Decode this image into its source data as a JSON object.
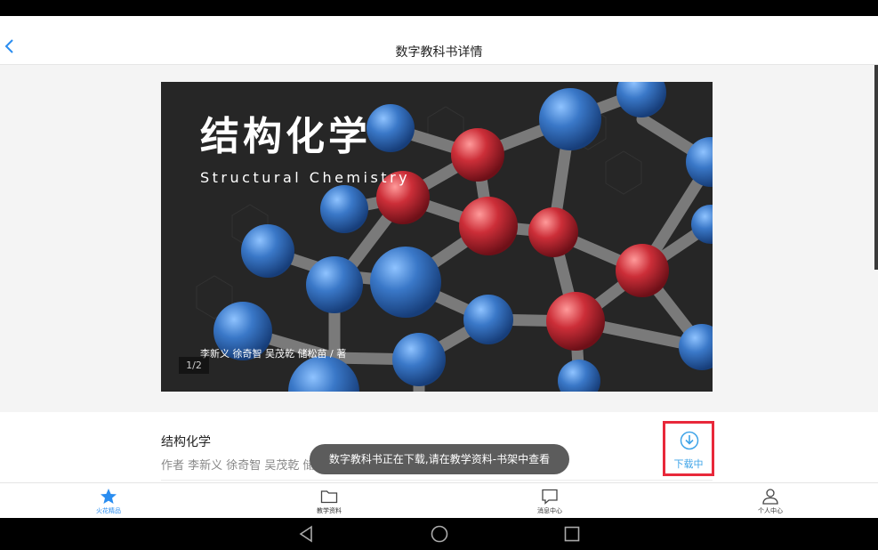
{
  "header": {
    "title": "数字教科书详情",
    "back_icon": "chevron-left-icon"
  },
  "cover": {
    "title": "结构化学",
    "subtitle": "Structural Chemistry",
    "authors": "李新义 徐奇智 吴茂乾 储松苗 / 著",
    "page_indicator": "1/2"
  },
  "book": {
    "title": "结构化学",
    "author": "作者 李新义 徐奇智 吴茂乾 储松",
    "download_label": "下载中",
    "download_icon": "download-icon"
  },
  "toast": {
    "message": "数字教科书正在下载,请在教学资料-书架中查看"
  },
  "tabs": [
    {
      "label": "火花精品",
      "icon": "star-icon",
      "active": true
    },
    {
      "label": "教学资料",
      "icon": "folder-icon",
      "active": false
    },
    {
      "label": "消息中心",
      "icon": "message-icon",
      "active": false
    },
    {
      "label": "个人中心",
      "icon": "person-icon",
      "active": false
    }
  ],
  "colors": {
    "accent": "#2a8df0",
    "download_blue": "#3fa4e8",
    "highlight_red": "#e8283a",
    "cover_bg": "#262626"
  }
}
